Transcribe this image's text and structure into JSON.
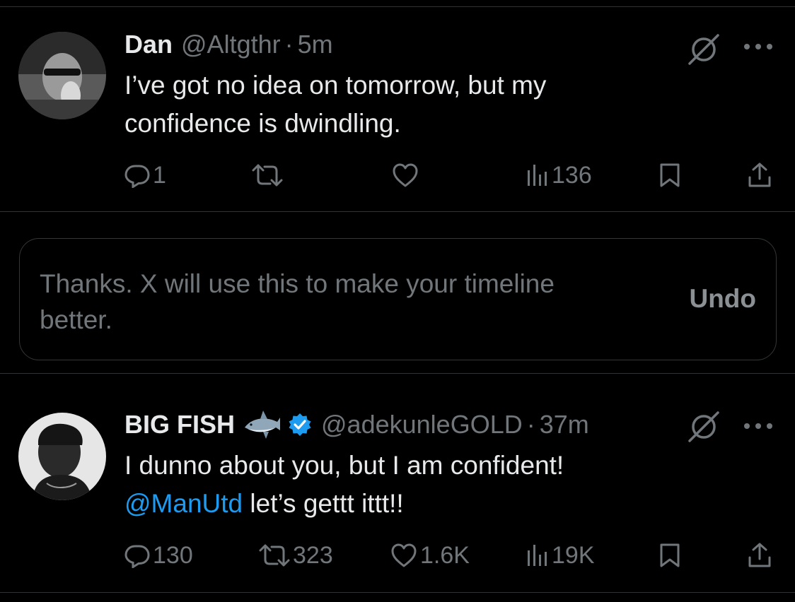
{
  "tweets": [
    {
      "name": "Dan",
      "handle": "@Altgthr",
      "separator": "·",
      "time": "5m",
      "text_lines": [
        "I’ve got no idea on tomorrow, but my",
        "confidence is dwindling."
      ],
      "stats": {
        "replies": "1",
        "reposts": "",
        "likes": "",
        "views": "136"
      }
    },
    {
      "name": "BIG FISH",
      "handle": "@adekunleGOLD",
      "separator": "·",
      "time": "37m",
      "text_line1": "I dunno about you, but I am confident!",
      "mention": "@ManUtd",
      "text_line2_rest": " let’s gettt ittt!!",
      "stats": {
        "replies": "130",
        "reposts": "323",
        "likes": "1.6K",
        "views": "19K"
      }
    }
  ],
  "notice": {
    "text": "Thanks. X will use this to make your timeline better.",
    "undo_label": "Undo"
  },
  "colors": {
    "background": "#000000",
    "text": "#e7e9ea",
    "muted": "#71767b",
    "link": "#1d9bf0",
    "verified": "#1d9bf0",
    "divider": "#2f3336"
  }
}
